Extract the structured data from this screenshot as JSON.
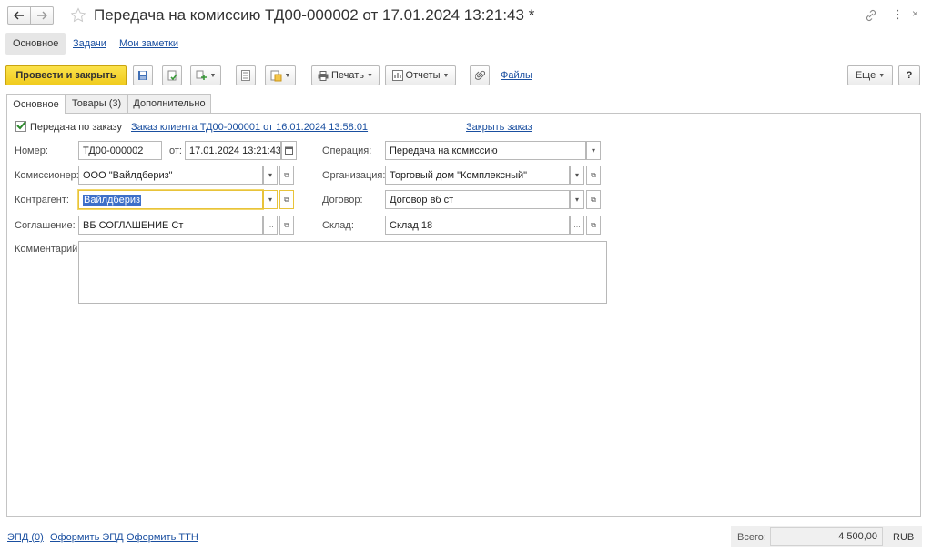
{
  "window": {
    "title": "Передача на комиссию ТД00-000002 от 17.01.2024 13:21:43 *"
  },
  "nav": {
    "items": [
      "Основное",
      "Задачи",
      "Мои заметки"
    ]
  },
  "toolbar": {
    "post_close": "Провести и закрыть",
    "print": "Печать",
    "reports": "Отчеты",
    "files": "Файлы",
    "more": "Еще",
    "help": "?"
  },
  "tabs": [
    "Основное",
    "Товары (3)",
    "Дополнительно"
  ],
  "form": {
    "checkbox_label": "Передача по заказу",
    "order_link": "Заказ клиента ТД00-000001 от 16.01.2024 13:58:01",
    "close_order": "Закрыть заказ",
    "number_label": "Номер:",
    "number_value": "ТД00-000002",
    "date_label": "от:",
    "date_value": "17.01.2024 13:21:43",
    "operation_label": "Операция:",
    "operation_value": "Передача на комиссию",
    "commissioner_label": "Комиссионер:",
    "commissioner_value": "ООО \"Вайлдбериз\"",
    "organization_label": "Организация:",
    "organization_value": "Торговый дом \"Комплексный\"",
    "counterparty_label": "Контрагент:",
    "counterparty_value": "Вайлдбериз",
    "contract_label": "Договор:",
    "contract_value": "Договор вб ст",
    "agreement_label": "Соглашение:",
    "agreement_value": "ВБ СОГЛАШЕНИЕ Ст",
    "warehouse_label": "Склад:",
    "warehouse_value": "Склад 18",
    "comment_label": "Комментарий:",
    "comment_value": ""
  },
  "footer": {
    "links": [
      "ЭПД (0)",
      "Оформить ЭПД",
      "Оформить ТТН"
    ],
    "total_label": "Всего:",
    "total_value": "4 500,00",
    "currency": "RUB"
  },
  "colors": {
    "accent_yellow": "#f5d52a",
    "link_blue": "#1a4fa0",
    "focus_border": "#e8c33a",
    "selection": "#3d6fc9"
  }
}
